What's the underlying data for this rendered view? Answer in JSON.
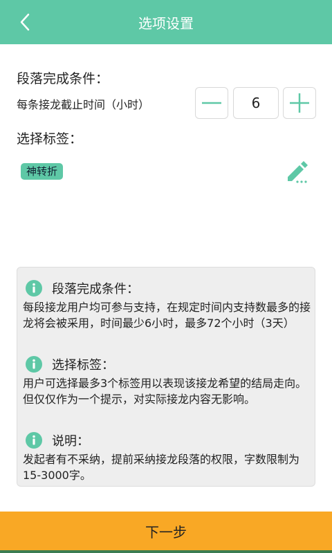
{
  "header": {
    "title": "选项设置",
    "back_icon": "chevron-left-icon"
  },
  "paragraph_condition": {
    "title": "段落完成条件：",
    "deadline_label": "每条接龙截止时间（小时）",
    "deadline_value": "6"
  },
  "tags": {
    "title": "选择标签：",
    "selected": "神转折",
    "edit_icon": "pencil-icon"
  },
  "info": [
    {
      "title": "段落完成条件：",
      "text": "每段接龙用户均可参与支持，在规定时间内支持数最多的接龙将会被采用，时间最少6小时，最多72个小时（3天）"
    },
    {
      "title": "选择标签：",
      "text": "用户可选择最多3个标签用以表现该接龙希望的结局走向。但仅仅作为一个提示，对实际接龙内容无影响。"
    },
    {
      "title": "说明：",
      "text": "发起者有不采纳，提前采纳接龙段落的权限，字数限制为15-3000字。"
    }
  ],
  "bottom_button": {
    "label": "下一步"
  },
  "colors": {
    "accent": "#5ec8a6",
    "button": "#f9a825"
  }
}
